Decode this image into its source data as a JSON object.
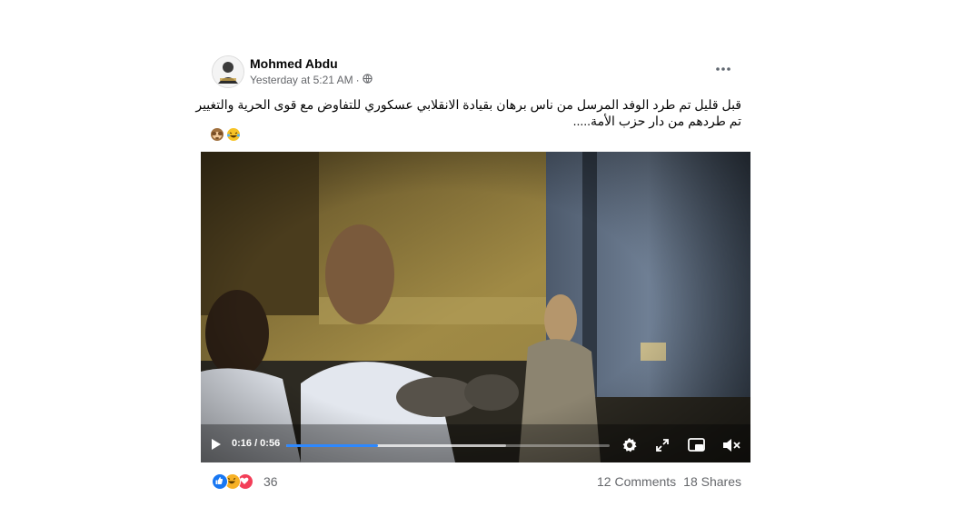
{
  "post": {
    "author": "Mohmed Abdu",
    "timestamp": "Yesterday at 5:21 AM",
    "separator": "·",
    "audience_icon": "globe-icon",
    "more_icon": "more-options-icon",
    "text_lines": [
      "قبل قليل تم طرد الوفد المرسل من ناس برهان بقيادة الانقلابي عسكوري للتفاوض مع قوى الحرية والتغيير",
      "تم طردهم من دار حزب الأمة....."
    ],
    "emojis": [
      "see-no-evil-monkey-icon",
      "laughing-face-icon"
    ]
  },
  "video": {
    "current_time": "0:16",
    "duration": "0:56",
    "time_label": "0:16 / 0:56",
    "progress_fraction": 0.285,
    "buffered_fraction": 0.68,
    "controls": [
      "play-icon",
      "settings-icon",
      "fullscreen-icon",
      "picture-in-picture-icon",
      "mute-icon"
    ]
  },
  "footer": {
    "reactions": [
      "like-icon",
      "haha-icon",
      "love-icon"
    ],
    "reaction_count": "36",
    "comments": "12 Comments",
    "shares": "18 Shares"
  },
  "colors": {
    "accent": "#2d88ff",
    "text_primary": "#050505",
    "text_secondary": "#65676b",
    "like": "#1877f2",
    "love": "#f33e58",
    "haha": "#f7b125"
  }
}
